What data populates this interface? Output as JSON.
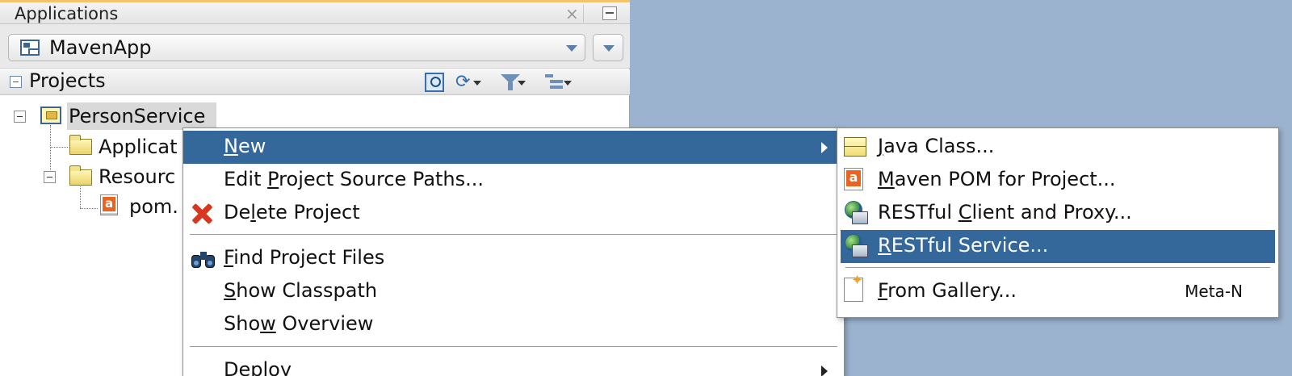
{
  "window": {
    "title": "Applications",
    "close_glyph": "×"
  },
  "app_selector": {
    "value": "MavenApp",
    "icon": "application-icon"
  },
  "projects_panel": {
    "title": "Projects",
    "toolbar_icons": [
      "locate-icon",
      "sync-icon",
      "filter-icon",
      "structure-icon"
    ]
  },
  "tree": {
    "project": "PersonService",
    "folder1": "Applicat",
    "folder2": "Resourc",
    "file": "pom."
  },
  "context_menu": {
    "items": [
      {
        "pre": "",
        "u": "N",
        "post": "ew",
        "has_submenu": true,
        "highlighted": true
      },
      {
        "pre": "Edit ",
        "u": "P",
        "post": "roject Source Paths..."
      },
      {
        "pre": "De",
        "u": "l",
        "post": "ete Project",
        "icon": "delete-icon"
      },
      {
        "pre": "",
        "u": "F",
        "post": "ind Project Files",
        "icon": "binoculars-icon"
      },
      {
        "pre": "",
        "u": "S",
        "post": "how Classpath"
      },
      {
        "pre": "Sho",
        "u": "w",
        "post": " Overview"
      },
      {
        "pre": "Deploy",
        "u": "",
        "post": "",
        "has_submenu": true
      }
    ]
  },
  "submenu": {
    "items": [
      {
        "pre": "",
        "u": "J",
        "post": "ava Class...",
        "icon": "java-class-icon"
      },
      {
        "pre": "",
        "u": "M",
        "post": "aven POM for Project...",
        "icon": "maven-pom-icon"
      },
      {
        "pre": "RESTful ",
        "u": "C",
        "post": "lient and Proxy...",
        "icon": "restful-client-icon"
      },
      {
        "pre": "",
        "u": "R",
        "post": "ESTful Service...",
        "icon": "restful-service-icon",
        "highlighted": true
      },
      {
        "pre": "",
        "u": "F",
        "post": "rom Gallery...",
        "icon": "gallery-icon",
        "shortcut": "Meta-N"
      }
    ]
  }
}
